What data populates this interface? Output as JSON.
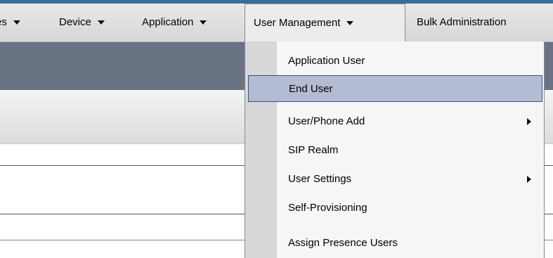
{
  "menubar": {
    "items": [
      {
        "label": "es"
      },
      {
        "label": "Device"
      },
      {
        "label": "Application"
      },
      {
        "label": "User Management"
      },
      {
        "label": "Bulk Administration"
      }
    ]
  },
  "user_management_menu": {
    "items": [
      {
        "label": "Application User",
        "submenu": false
      },
      {
        "label": "End User",
        "submenu": false,
        "selected": true
      },
      {
        "label": "User/Phone Add",
        "submenu": true
      },
      {
        "label": "SIP Realm",
        "submenu": false
      },
      {
        "label": "User Settings",
        "submenu": true
      },
      {
        "label": "Self-Provisioning",
        "submenu": false
      },
      {
        "label": "Assign Presence Users",
        "submenu": false
      }
    ]
  }
}
